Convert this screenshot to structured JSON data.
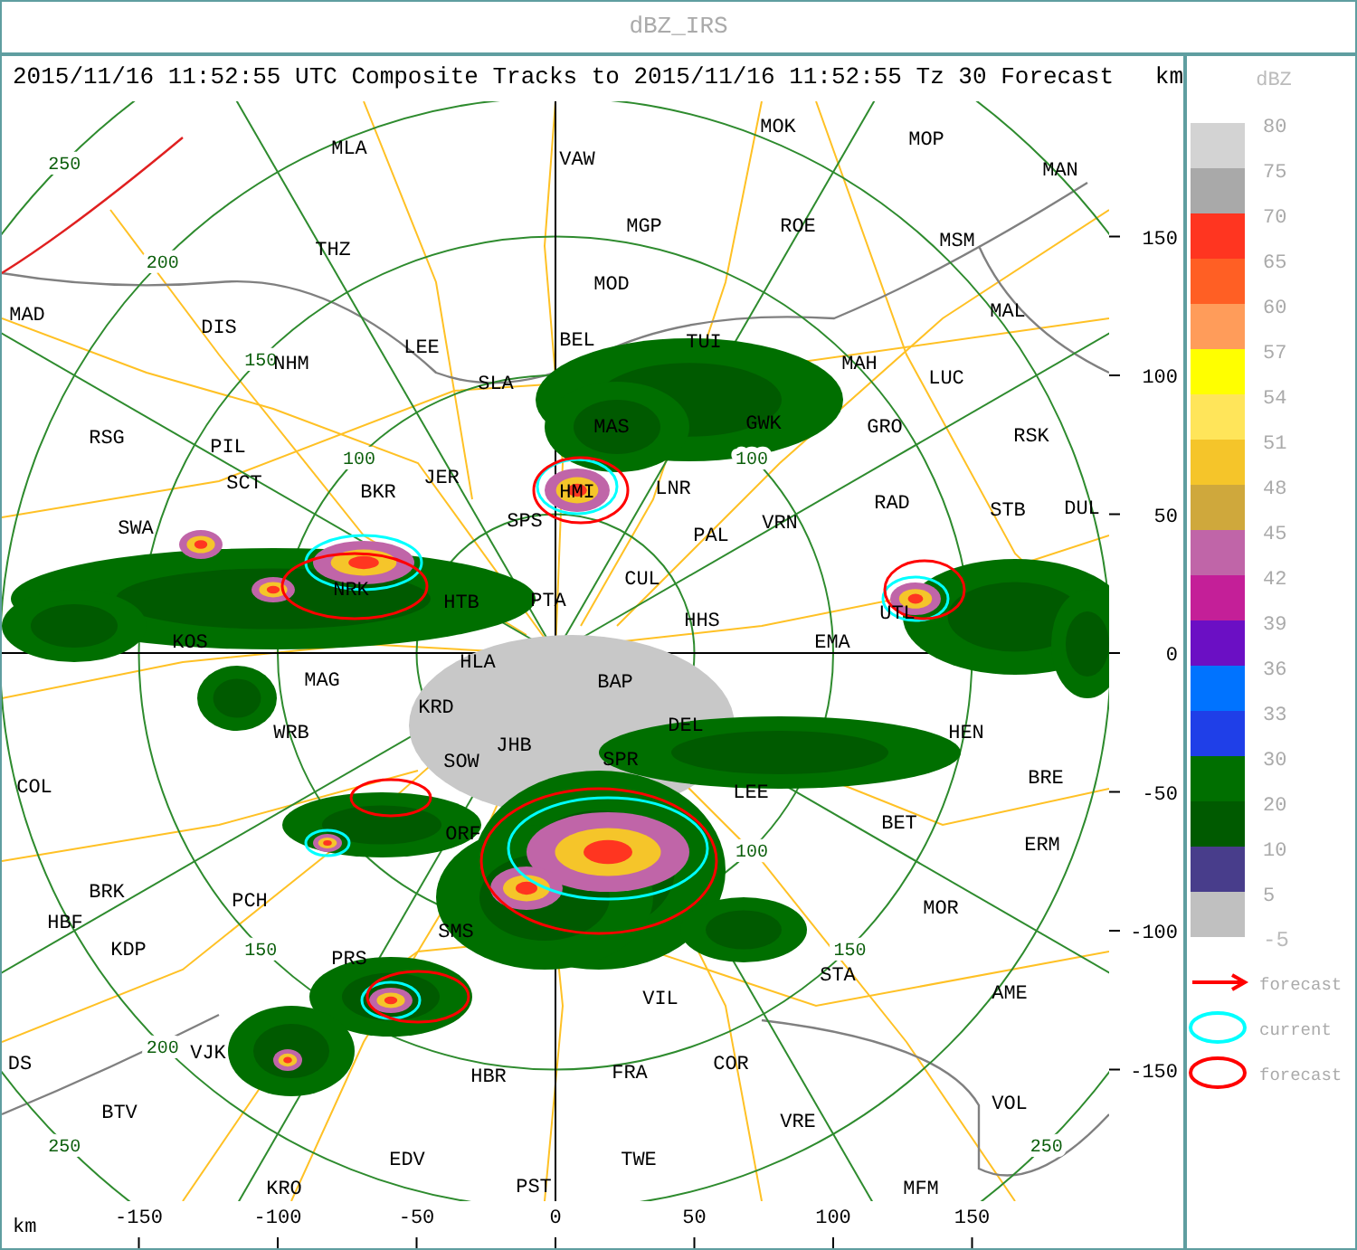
{
  "window": {
    "title": "dBZ_IRS"
  },
  "header": {
    "title": "2015/11/16 11:52:55 UTC Composite Tracks to 2015/11/16 11:52:55 Tz 30 Forecast",
    "unit": "km"
  },
  "map": {
    "ring_labels": [
      "250",
      "200",
      "150",
      "100",
      "100",
      "100",
      "150",
      "150",
      "200",
      "250",
      "250"
    ],
    "stations": [
      "MOK",
      "MLA",
      "MOP",
      "VAW",
      "MAN",
      "MGP",
      "ROE",
      "THZ",
      "MSM",
      "MOD",
      "MAD",
      "MAL",
      "DIS",
      "LEE",
      "BEL",
      "TUI",
      "NHM",
      "MAH",
      "SLA",
      "LUC",
      "MAS",
      "GWK",
      "GRO",
      "RSG",
      "RSK",
      "PIL",
      "SCT",
      "JER",
      "BKR",
      "HMI",
      "LNR",
      "RAD",
      "STB",
      "DUL",
      "SWA",
      "SPS",
      "VRN",
      "PAL",
      "CUL",
      "NRK",
      "HTB",
      "PTA",
      "HHS",
      "UTL",
      "KOS",
      "EMA",
      "HLA",
      "MAG",
      "BAP",
      "KRD",
      "WRB",
      "DEL",
      "HEN",
      "JHB",
      "SOW",
      "SPR",
      "BRE",
      "COL",
      "LEE",
      "BET",
      "ORF",
      "ERM",
      "BRK",
      "PCH",
      "MOR",
      "HBF",
      "SMS",
      "KDP",
      "PRS",
      "STA",
      "VIL",
      "AME",
      "VJK",
      "DS",
      "COR",
      "HBR",
      "FRA",
      "VOL",
      "BTV",
      "VRE",
      "EDV",
      "TWE",
      "KRO",
      "PST",
      "MFM"
    ]
  },
  "y_axis": {
    "ticks": [
      "150",
      "100",
      "50",
      "0",
      "-50",
      "-100",
      "-150"
    ]
  },
  "x_axis": {
    "unit": "km",
    "ticks": [
      "-150",
      "-100",
      "-50",
      "0",
      "50",
      "100",
      "150"
    ]
  },
  "legend": {
    "title": "dBZ",
    "bottom_label": "-5",
    "bands": [
      {
        "label": "80",
        "color": "#d3d3d3"
      },
      {
        "label": "75",
        "color": "#a9a9a9"
      },
      {
        "label": "70",
        "color": "#ff3520"
      },
      {
        "label": "65",
        "color": "#ff5f24"
      },
      {
        "label": "60",
        "color": "#ff9c5a"
      },
      {
        "label": "57",
        "color": "#ffff00"
      },
      {
        "label": "54",
        "color": "#ffe55a"
      },
      {
        "label": "51",
        "color": "#f5c52a"
      },
      {
        "label": "48",
        "color": "#cfa83c"
      },
      {
        "label": "45",
        "color": "#c065a8"
      },
      {
        "label": "42",
        "color": "#c41f98"
      },
      {
        "label": "39",
        "color": "#6b0fc4"
      },
      {
        "label": "36",
        "color": "#0073ff"
      },
      {
        "label": "33",
        "color": "#1f3fe8"
      },
      {
        "label": "30",
        "color": "#006f00"
      },
      {
        "label": "20",
        "color": "#005a00"
      },
      {
        "label": "10",
        "color": "#483d8b"
      },
      {
        "label": "5",
        "color": "#c0c0c0"
      }
    ],
    "key": [
      {
        "kind": "arrow",
        "label": "forecast",
        "color": "#ff0000"
      },
      {
        "kind": "outline",
        "label": "current",
        "color": "#00ffff"
      },
      {
        "kind": "outline",
        "label": "forecast",
        "color": "#ff0000"
      }
    ]
  }
}
